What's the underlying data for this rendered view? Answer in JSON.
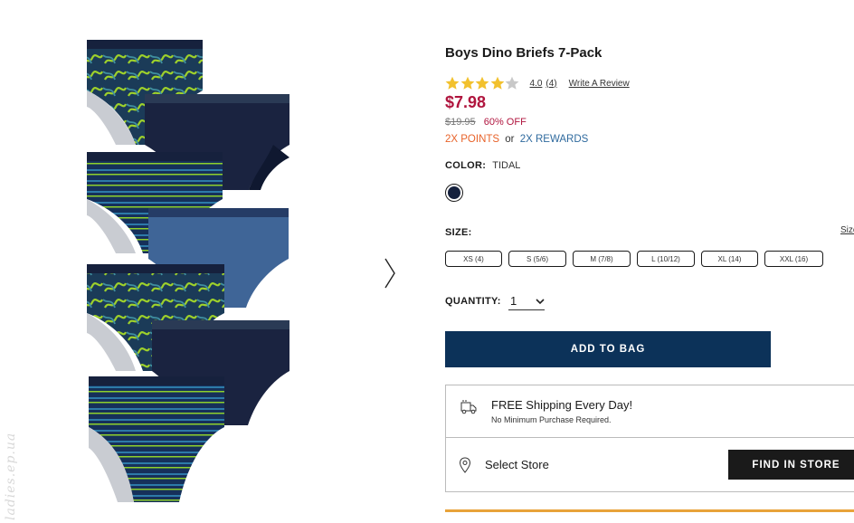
{
  "product": {
    "title": "Boys Dino Briefs 7-Pack",
    "rating_value": "4.0",
    "rating_count": "(4)",
    "rating_stars": 4,
    "write_review": "Write A Review",
    "price": "$7.98",
    "was_price": "$19.95",
    "discount": "60% OFF",
    "points": "2X POINTS",
    "or_text": "or",
    "rewards": "2X REWARDS"
  },
  "color": {
    "label": "COLOR:",
    "value": "TIDAL",
    "swatch": "#15213d"
  },
  "size": {
    "label": "SIZE:",
    "chart_link": "Size",
    "options": [
      "XS (4)",
      "S (5/6)",
      "M (7/8)",
      "L (10/12)",
      "XL (14)",
      "XXL (16)"
    ]
  },
  "quantity": {
    "label": "QUANTITY:",
    "value": "1"
  },
  "actions": {
    "add_to_bag": "ADD TO BAG",
    "find_in_store": "FIND IN STORE"
  },
  "shipping": {
    "title": "FREE Shipping Every Day!",
    "subtitle": "No Minimum Purchase Required.",
    "select_store": "Select Store"
  },
  "watermark": "ladies.ep.ua",
  "colors": {
    "navy_button": "#0c3259",
    "price_red": "#b0153e",
    "points_orange": "#e8632a",
    "rewards_blue": "#2f6a9e",
    "star_fill": "#f2c12e",
    "accent_bar": "#e8a33a"
  },
  "icons": [
    "chevron-right-icon",
    "star-icon",
    "chevron-down-icon",
    "truck-icon",
    "location-pin-icon"
  ]
}
